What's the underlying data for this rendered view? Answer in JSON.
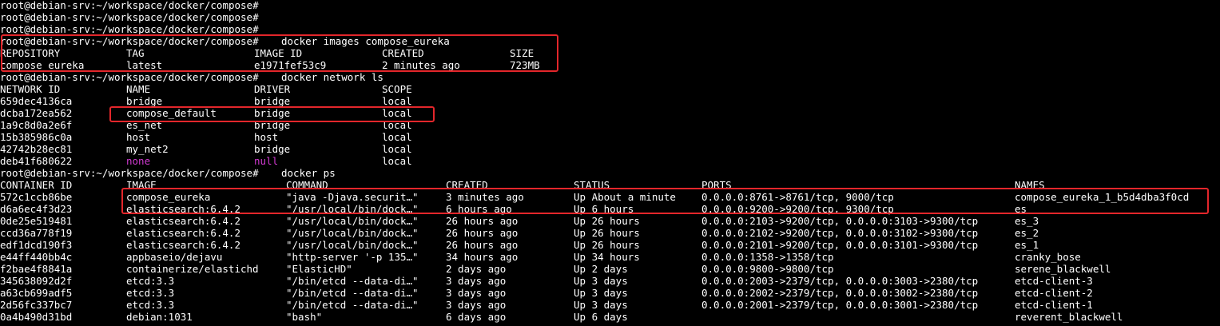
{
  "colors": {
    "background": "#000000",
    "text": "#ffffff",
    "null_value": "#d23ad2",
    "highlight": "#e3262b"
  },
  "prompt": "root@debian-srv:~/workspace/docker/compose#",
  "lines": [
    {
      "kind": "prompt",
      "command": ""
    },
    {
      "kind": "prompt",
      "command": ""
    },
    {
      "kind": "prompt",
      "command": ""
    },
    {
      "kind": "prompt",
      "command": "docker images compose_eureka"
    },
    {
      "kind": "images",
      "cells": [
        "REPOSITORY",
        "TAG",
        "IMAGE ID",
        "CREATED",
        "SIZE"
      ]
    },
    {
      "kind": "images",
      "cells": [
        "compose_eureka",
        "latest",
        "e1971fef53c9",
        "2 minutes ago",
        "723MB"
      ]
    },
    {
      "kind": "prompt",
      "command": "docker network ls"
    },
    {
      "kind": "network",
      "cells": [
        "NETWORK ID",
        "NAME",
        "DRIVER",
        "SCOPE"
      ]
    },
    {
      "kind": "network",
      "cells": [
        "659dec4136ca",
        "bridge",
        "bridge",
        "local"
      ]
    },
    {
      "kind": "network",
      "cells": [
        "dcba172ea562",
        "compose_default",
        "bridge",
        "local"
      ]
    },
    {
      "kind": "network",
      "cells": [
        "1a9c8d0a2e6f",
        "es_net",
        "bridge",
        "local"
      ]
    },
    {
      "kind": "network",
      "cells": [
        "15b385986c0a",
        "host",
        "host",
        "local"
      ]
    },
    {
      "kind": "network",
      "cells": [
        "42742b28ec81",
        "my_net2",
        "bridge",
        "local"
      ]
    },
    {
      "kind": "network",
      "cells": [
        "deb41f680622",
        "none",
        "null",
        "local"
      ],
      "colored": [
        1,
        2
      ]
    },
    {
      "kind": "prompt",
      "command": "docker ps"
    },
    {
      "kind": "ps",
      "cells": [
        "CONTAINER ID",
        "IMAGE",
        "COMMAND",
        "CREATED",
        "STATUS",
        "PORTS",
        "NAMES"
      ]
    },
    {
      "kind": "ps",
      "cells": [
        "572c1ccb86be",
        "compose_eureka",
        "\"java -Djava.securit…\"",
        "3 minutes ago",
        "Up About a minute",
        "0.0.0.0:8761->8761/tcp, 9000/tcp",
        "compose_eureka_1_b5d4dba3f0cd"
      ]
    },
    {
      "kind": "ps",
      "cells": [
        "d6a6ec4f3d23",
        "elasticsearch:6.4.2",
        "\"/usr/local/bin/dock…\"",
        "6 hours ago",
        "Up 6 hours",
        "0.0.0.0:9200->9200/tcp, 9300/tcp",
        "es"
      ]
    },
    {
      "kind": "ps",
      "cells": [
        "0de25e519481",
        "elasticsearch:6.4.2",
        "\"/usr/local/bin/dock…\"",
        "26 hours ago",
        "Up 26 hours",
        "0.0.0.0:2103->9200/tcp, 0.0.0.0:3103->9300/tcp",
        "es_3"
      ]
    },
    {
      "kind": "ps",
      "cells": [
        "ccd36a778f19",
        "elasticsearch:6.4.2",
        "\"/usr/local/bin/dock…\"",
        "26 hours ago",
        "Up 26 hours",
        "0.0.0.0:2102->9200/tcp, 0.0.0.0:3102->9300/tcp",
        "es_2"
      ]
    },
    {
      "kind": "ps",
      "cells": [
        "edf1dcd190f3",
        "elasticsearch:6.4.2",
        "\"/usr/local/bin/dock…\"",
        "26 hours ago",
        "Up 26 hours",
        "0.0.0.0:2101->9200/tcp, 0.0.0.0:3101->9300/tcp",
        "es_1"
      ]
    },
    {
      "kind": "ps",
      "cells": [
        "e44ff440bb4c",
        "appbaseio/dejavu",
        "\"http-server '-p 135…\"",
        "34 hours ago",
        "Up 34 hours",
        "0.0.0.0:1358->1358/tcp",
        "cranky_bose"
      ]
    },
    {
      "kind": "ps",
      "cells": [
        "f2bae4f8841a",
        "containerize/elastichd",
        "\"ElasticHD\"",
        "2 days ago",
        "Up 2 days",
        "0.0.0.0:9800->9800/tcp",
        "serene_blackwell"
      ]
    },
    {
      "kind": "ps",
      "cells": [
        "345638092d2f",
        "etcd:3.3",
        "\"/bin/etcd --data-di…\"",
        "3 days ago",
        "Up 3 days",
        "0.0.0.0:2003->2379/tcp, 0.0.0.0:3003->2380/tcp",
        "etcd-client-3"
      ]
    },
    {
      "kind": "ps",
      "cells": [
        "a63cb699adf5",
        "etcd:3.3",
        "\"/bin/etcd --data-di…\"",
        "3 days ago",
        "Up 3 days",
        "0.0.0.0:2002->2379/tcp, 0.0.0.0:3002->2380/tcp",
        "etcd-client-2"
      ]
    },
    {
      "kind": "ps",
      "cells": [
        "2d56fc337bc7",
        "etcd:3.3",
        "\"/bin/etcd --data-di…\"",
        "3 days ago",
        "Up 3 days",
        "0.0.0.0:2001->2379/tcp, 0.0.0.0:3001->2380/tcp",
        "etcd-client-1"
      ]
    },
    {
      "kind": "ps",
      "cells": [
        "0a4b490d31bd",
        "debian:1031",
        "\"bash\"",
        "6 days ago",
        "Up 6 days",
        "",
        "reverent_blackwell"
      ]
    }
  ]
}
